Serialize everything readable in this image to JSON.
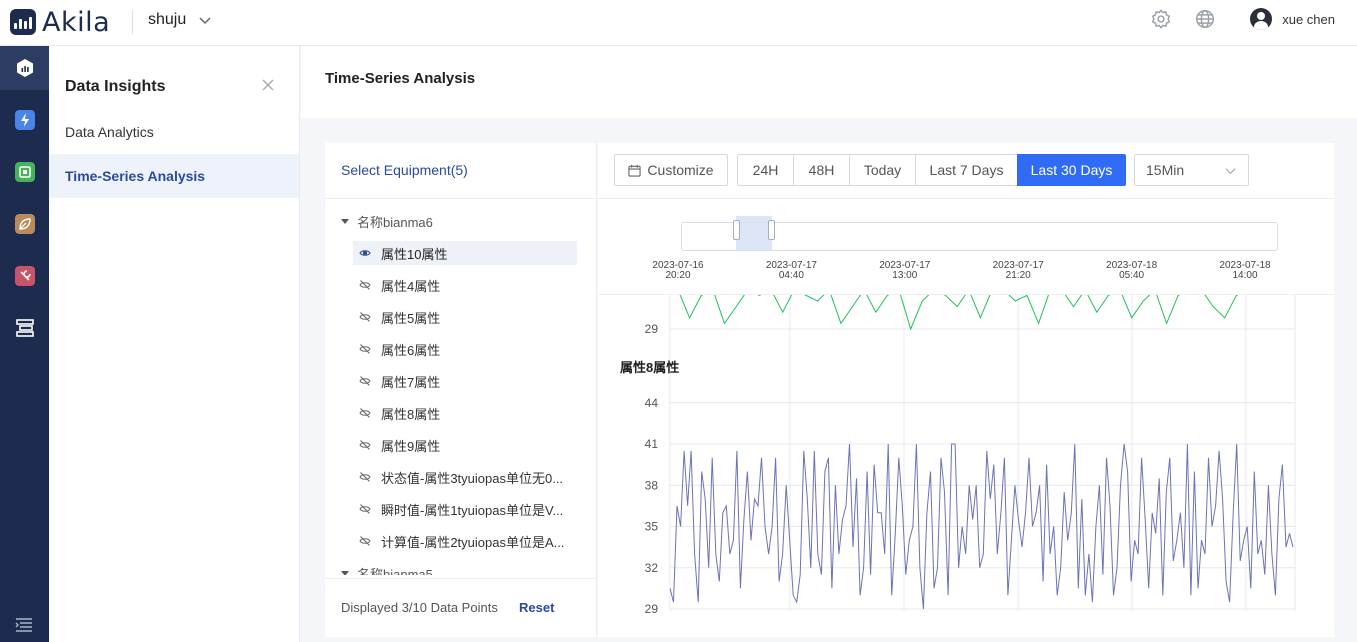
{
  "brand": {
    "name": "Akila"
  },
  "workspace": {
    "name": "shuju"
  },
  "user": {
    "name": "xue chen"
  },
  "icons": {
    "settings": "gear-icon",
    "language": "globe-icon",
    "close": "close-icon",
    "calendar": "calendar-icon",
    "dropdown": "chevron-down-icon",
    "visible": "eye-icon",
    "hidden": "eye-off-icon"
  },
  "colors": {
    "accent": "#2f6bf5",
    "rail": "#1d2b4f",
    "series_purple": "#6b73b6",
    "series_green": "#21c05b"
  },
  "sidenav": {
    "title": "Data Insights",
    "items": [
      {
        "label": "Data Analytics",
        "active": false
      },
      {
        "label": "Time-Series Analysis",
        "active": true
      }
    ]
  },
  "page": {
    "title": "Time-Series Analysis"
  },
  "equipment": {
    "title": "Select Equipment(5)",
    "groups": [
      {
        "name": "名称bianma6",
        "items": [
          {
            "label": "属性10属性",
            "visible": true
          },
          {
            "label": "属性4属性",
            "visible": false
          },
          {
            "label": "属性5属性",
            "visible": false
          },
          {
            "label": "属性6属性",
            "visible": false
          },
          {
            "label": "属性7属性",
            "visible": false
          },
          {
            "label": "属性8属性",
            "visible": false
          },
          {
            "label": "属性9属性",
            "visible": false
          },
          {
            "label": "状态值-属性3tyuiopas单位无0...",
            "visible": false
          },
          {
            "label": "瞬时值-属性1tyuiopas单位是V...",
            "visible": false
          },
          {
            "label": "计算值-属性2tyuiopas单位是A...",
            "visible": false
          }
        ]
      },
      {
        "name": "名称bianma5",
        "items": []
      }
    ],
    "footer": {
      "displayed": "Displayed 3/10 Data Points",
      "reset": "Reset"
    }
  },
  "toolbar": {
    "customize": "Customize",
    "ranges": [
      {
        "label": "24H",
        "active": false
      },
      {
        "label": "48H",
        "active": false
      },
      {
        "label": "Today",
        "active": false
      },
      {
        "label": "Last 7 Days",
        "active": false
      },
      {
        "label": "Last 30 Days",
        "active": true
      }
    ],
    "interval": {
      "value": "15Min"
    }
  },
  "timeline": {
    "ticks": [
      {
        "date": "2023-07-16",
        "time": "20:20"
      },
      {
        "date": "2023-07-17",
        "time": "04:40"
      },
      {
        "date": "2023-07-17",
        "time": "13:00"
      },
      {
        "date": "2023-07-17",
        "time": "21:20"
      },
      {
        "date": "2023-07-18",
        "time": "05:40"
      },
      {
        "date": "2023-07-18",
        "time": "14:00"
      }
    ],
    "window": {
      "start": 0.09,
      "end": 0.15
    }
  },
  "chart_data": [
    {
      "type": "line",
      "title": "",
      "y_ticks": [
        29
      ],
      "ylim": [
        29,
        44
      ],
      "series": [
        {
          "values": [
            36,
            31,
            35,
            36,
            30,
            33,
            36,
            35,
            36,
            32,
            36,
            35,
            34,
            36,
            30,
            33,
            36,
            32,
            35,
            36,
            29,
            34,
            36,
            35,
            33,
            36,
            31,
            36,
            36,
            34,
            35,
            30,
            36,
            36,
            33,
            36,
            32,
            35,
            36,
            31,
            34,
            36,
            30,
            35,
            36,
            36,
            33,
            31,
            35,
            36
          ]
        }
      ]
    },
    {
      "type": "line",
      "title": "属性8属性",
      "y_ticks": [
        29,
        32,
        35,
        38,
        41,
        44
      ],
      "ylim": [
        29,
        45
      ],
      "series": [
        {
          "values": [
            30.5,
            29.5,
            36.5,
            35,
            40.5,
            36.5,
            40.5,
            33,
            29.5,
            39,
            37,
            32,
            40,
            33,
            31,
            36,
            36.5,
            33,
            34,
            40.5,
            30.5,
            35.5,
            39,
            34,
            37,
            36.5,
            40,
            35,
            33,
            35,
            40,
            31,
            33,
            38,
            34,
            30,
            29.5,
            31.5,
            40.5,
            37,
            32,
            40.5,
            33,
            31.5,
            39,
            40,
            30.5,
            38,
            33,
            35.5,
            36.5,
            41,
            33.5,
            38.5,
            30,
            32,
            39,
            31.5,
            39.5,
            36,
            36,
            33,
            41,
            30,
            34.5,
            40,
            36.5,
            31.5,
            34,
            35,
            41,
            32,
            29,
            36,
            39,
            30.5,
            32,
            40,
            37.5,
            30,
            41,
            41,
            32,
            35,
            33,
            38,
            35.5,
            38,
            32,
            33,
            40.5,
            37,
            39.5,
            33,
            36,
            40,
            30,
            34,
            38,
            35.5,
            33.5,
            36,
            40,
            35,
            36,
            38,
            31,
            39.5,
            33,
            35,
            30,
            32,
            37.5,
            34,
            36,
            41,
            30.5,
            37,
            30,
            33,
            29.5,
            35,
            38,
            31.5,
            40,
            36.5,
            30,
            32,
            38,
            41,
            39,
            31,
            34,
            33,
            40,
            35.5,
            30.5,
            36,
            34.5,
            38.5,
            30,
            37.5,
            40,
            32.5,
            34,
            36,
            32,
            41,
            30,
            39,
            30.5,
            34,
            33,
            40,
            35,
            36.5,
            40.5,
            37,
            31,
            29.5,
            36,
            41,
            32.5,
            34,
            35,
            30.5,
            39,
            33,
            34,
            31.5,
            38,
            33,
            30,
            37,
            39.5,
            33.5,
            34.5,
            33.5
          ]
        }
      ]
    }
  ]
}
